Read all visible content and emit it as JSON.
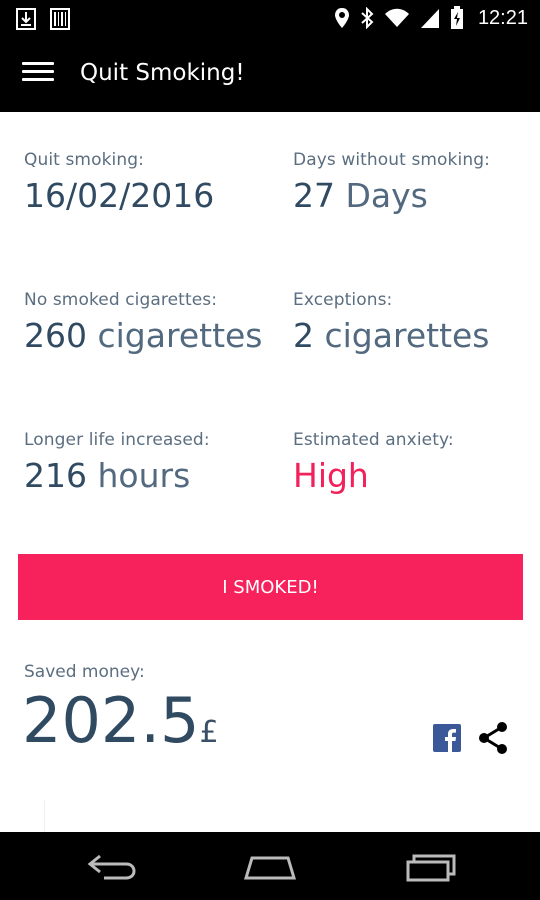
{
  "status_bar": {
    "time": "12:21",
    "icons": [
      "download-icon",
      "barcode-icon",
      "location-icon",
      "bluetooth-icon",
      "wifi-icon",
      "signal-icon",
      "battery-icon"
    ]
  },
  "app_bar": {
    "title": "Quit Smoking!",
    "menu_icon": "hamburger-menu-icon"
  },
  "stats": {
    "quit_date": {
      "label": "Quit smoking:",
      "value": "16/02/2016"
    },
    "days_without": {
      "label": "Days without smoking:",
      "number": "27",
      "unit": "Days"
    },
    "no_smoked": {
      "label": "No smoked cigarettes:",
      "number": "260",
      "unit": "cigarettes"
    },
    "exceptions": {
      "label": "Exceptions:",
      "number": "2",
      "unit": "cigarettes"
    },
    "longer_life": {
      "label": "Longer life increased:",
      "number": "216",
      "unit": "hours"
    },
    "anxiety": {
      "label": "Estimated anxiety:",
      "value": "High",
      "color": "#f2215b"
    }
  },
  "smoked_button": {
    "label": "I SMOKED!",
    "color": "#f7215c"
  },
  "saved_money": {
    "label": "Saved money:",
    "amount": "202.5",
    "currency": "£"
  },
  "share": {
    "facebook_icon": "facebook-icon",
    "share_icon": "share-icon",
    "facebook_color": "#3b5998"
  },
  "nav_bar": {
    "icons": [
      "back-icon",
      "home-icon",
      "recent-apps-icon"
    ]
  }
}
